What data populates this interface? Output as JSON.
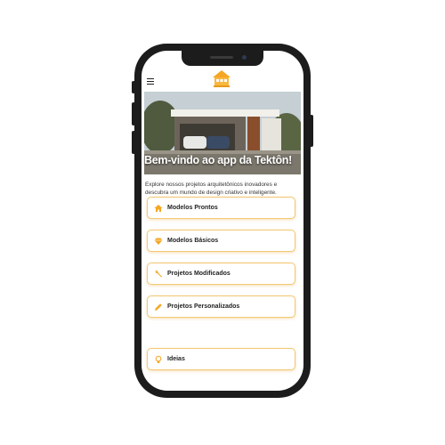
{
  "hero": {
    "title": "Bem-vindo ao app da Tektôn!"
  },
  "intro": {
    "description": "Explore nossos projetos arquitetônicos inovadores e descubra um mundo de design criativo e inteligente."
  },
  "menu": [
    {
      "label": "Modelos Prontos",
      "icon": "home-icon"
    },
    {
      "label": "Modelos Básicos",
      "icon": "diamond-icon"
    },
    {
      "label": "Projetos Modificados",
      "icon": "wrench-icon"
    },
    {
      "label": "Projetos Personalizados",
      "icon": "pencil-icon"
    },
    {
      "label": "Ideias",
      "icon": "lightbulb-icon"
    }
  ],
  "colors": {
    "accent": "#f5a623",
    "card_border": "#f2c874"
  }
}
